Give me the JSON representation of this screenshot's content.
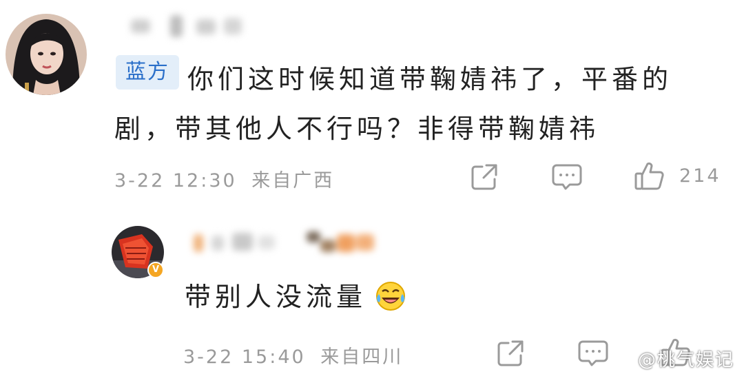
{
  "comment": {
    "tag": "蓝方",
    "text_line1": "你们这时候知道带鞠婧祎了，平番的",
    "text_line2": "剧，带其他人不行吗？非得带鞠婧祎",
    "time": "3-22 12:30",
    "location": "来自广西",
    "likes": "214"
  },
  "reply": {
    "text": "带别人没流量",
    "emoji": "laughing-crying-emoji",
    "time": "3-22 15:40",
    "location": "来自四川"
  },
  "watermark": "@桃气娱记",
  "icons": {
    "share": "share-icon",
    "comment": "comment-icon",
    "like": "thumbs-up-icon",
    "verified": "verified-v-icon"
  },
  "colors": {
    "tag_bg": "#e3eef9",
    "tag_text": "#2a6fc9",
    "meta_text": "#9a9a9a",
    "body_text": "#222222",
    "verified_badge": "#f5a623"
  }
}
